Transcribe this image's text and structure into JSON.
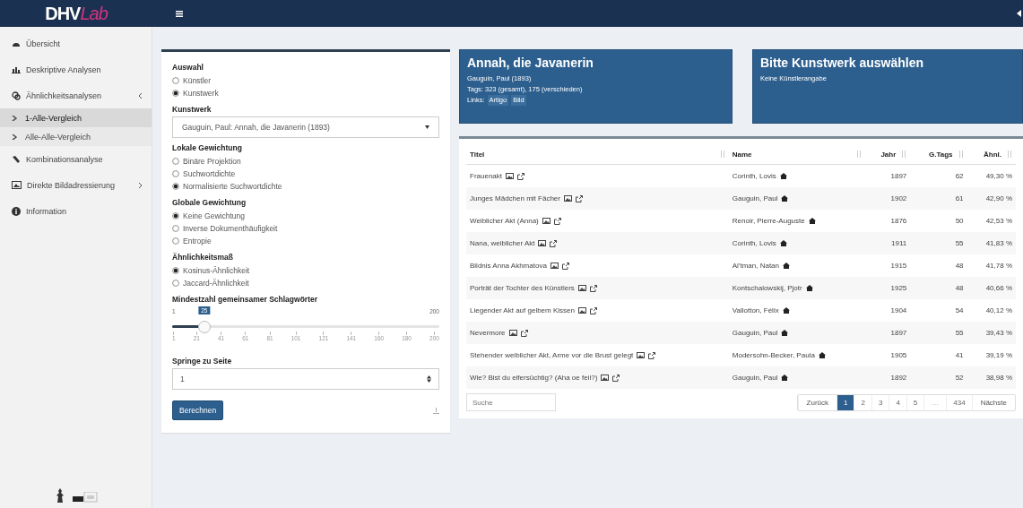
{
  "header": {
    "logo_main": "DHV",
    "logo_accent": "Lab"
  },
  "sidebar": {
    "items": [
      {
        "label": "Übersicht",
        "selected": false
      },
      {
        "label": "Deskriptive Analysen",
        "selected": false
      },
      {
        "label": "Ähnlichkeitsanalysen",
        "selected": false,
        "expanded": true,
        "children": [
          {
            "label": "1-Alle-Vergleich",
            "selected": true
          },
          {
            "label": "Alle-Alle-Vergleich",
            "selected": false
          }
        ]
      },
      {
        "label": "Kombinationsanalyse",
        "selected": false
      },
      {
        "label": "Direkte Bildadressierung",
        "selected": false,
        "expanded": false
      },
      {
        "label": "Information",
        "selected": false
      }
    ]
  },
  "form": {
    "sections": [
      {
        "kind": "radio",
        "label": "Auswahl",
        "options": [
          {
            "label": "Künstler",
            "selected": false
          },
          {
            "label": "Kunstwerk",
            "selected": true
          }
        ]
      },
      {
        "kind": "select",
        "label": "Kunstwerk",
        "value": "Gauguin, Paul: Annah, die Javanerin (1893)"
      },
      {
        "kind": "radio",
        "label": "Lokale Gewichtung",
        "options": [
          {
            "label": "Binäre Projektion",
            "selected": false
          },
          {
            "label": "Suchwortdichte",
            "selected": false
          },
          {
            "label": "Normalisierte Suchwortdichte",
            "selected": true
          }
        ]
      },
      {
        "kind": "radio",
        "label": "Globale Gewichtung",
        "options": [
          {
            "label": "Keine Gewichtung",
            "selected": true
          },
          {
            "label": "Inverse Dokumenthäufigkeit",
            "selected": false
          },
          {
            "label": "Entropie",
            "selected": false
          }
        ]
      },
      {
        "kind": "radio",
        "label": "Ähnlichkeitsmaß",
        "options": [
          {
            "label": "Kosinus-Ähnlichkeit",
            "selected": true
          },
          {
            "label": "Jaccard-Ähnlichkeit",
            "selected": false
          }
        ]
      },
      {
        "kind": "slider",
        "label": "Mindestzahl gemeinsamer Schlagwörter",
        "min": "1",
        "max": "200",
        "value": "25",
        "level": 0.12,
        "ticks": [
          "1",
          "21",
          "41",
          "61",
          "81",
          "101",
          "121",
          "141",
          "160",
          "180",
          "200"
        ]
      },
      {
        "kind": "number",
        "label": "Springe zu Seite",
        "value": "1"
      }
    ],
    "button": "Berechnen"
  },
  "cards": [
    {
      "title": "Annah, die Javanerin",
      "lines": [
        "Gauguin, Paul (1893)",
        "Tags: 323 (gesamt), 175 (verschieden)"
      ],
      "links_label": "Links:",
      "links": [
        "Artigo",
        "Bild"
      ]
    },
    {
      "title": "Bitte Kunstwerk auswählen",
      "lines": [
        "Keine Künstlerangabe"
      ]
    }
  ],
  "table": {
    "columns": [
      "Titel",
      "Name",
      "Jahr",
      "G.Tags",
      "Ähnl."
    ],
    "rows": [
      [
        "Frauenakt",
        "Corinth, Lovis",
        "1897",
        "62",
        "49,30 %"
      ],
      [
        "Junges Mädchen mit Fächer",
        "Gauguin, Paul",
        "1902",
        "61",
        "42,90 %"
      ],
      [
        "Weiblicher Akt (Anna)",
        "Renoir, Pierre-Auguste",
        "1876",
        "50",
        "42,53 %"
      ],
      [
        "Nana, weiblicher Akt",
        "Corinth, Lovis",
        "1911",
        "55",
        "41,83 %"
      ],
      [
        "Bildnis Anna Akhmatova",
        "Al'tman, Natan",
        "1915",
        "48",
        "41,78 %"
      ],
      [
        "Porträt der Tochter des Künstlers",
        "Kontschalowskij, Pjotr",
        "1925",
        "48",
        "40,66 %"
      ],
      [
        "Liegender Akt auf gelbem Kissen",
        "Vallotton, Félix",
        "1904",
        "54",
        "40,12 %"
      ],
      [
        "Nevermore",
        "Gauguin, Paul",
        "1897",
        "55",
        "39,43 %"
      ],
      [
        "Stehender weiblicher Akt, Arme vor die Brust gelegt",
        "Modersohn-Becker, Paula",
        "1905",
        "41",
        "39,19 %"
      ],
      [
        "Wie? Bist du eifersüchtig? (Aha oe feii?)",
        "Gauguin, Paul",
        "1892",
        "52",
        "38,98 %"
      ]
    ],
    "search_placeholder": "Suche",
    "pagination": [
      {
        "label": "Zurück",
        "kind": "nav",
        "selected": false
      },
      {
        "label": "1",
        "kind": "page",
        "selected": true
      },
      {
        "label": "2",
        "kind": "page",
        "selected": false
      },
      {
        "label": "3",
        "kind": "page",
        "selected": false
      },
      {
        "label": "4",
        "kind": "page",
        "selected": false
      },
      {
        "label": "5",
        "kind": "page",
        "selected": false
      },
      {
        "label": "…",
        "kind": "gap",
        "selected": false
      },
      {
        "label": "434",
        "kind": "page",
        "selected": false
      },
      {
        "label": "Nächste",
        "kind": "nav",
        "selected": false
      }
    ]
  }
}
